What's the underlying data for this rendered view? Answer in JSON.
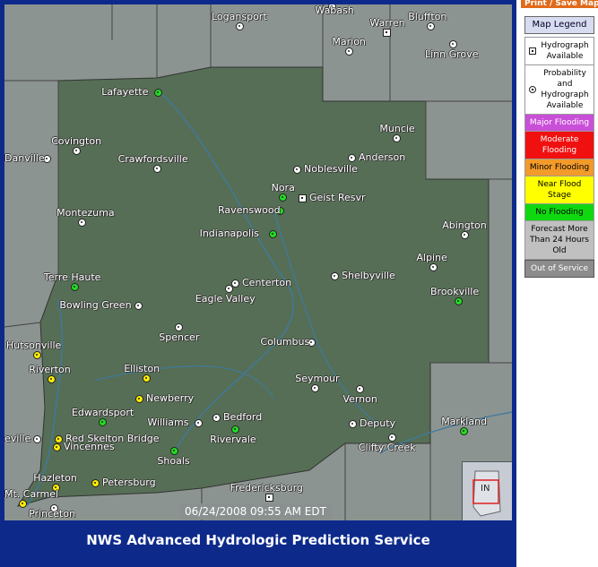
{
  "header": {
    "print_label": "Print / Save Map"
  },
  "legend": {
    "button_label": "Map Legend",
    "items": [
      {
        "label": "Hydrograph Available",
        "icon": "square-marker-icon"
      },
      {
        "label": "Probability and Hydrograph Available",
        "icon": "circle-marker-icon"
      },
      {
        "label": "Major Flooding",
        "color": "#c94fd8",
        "text_color": "#ffffff"
      },
      {
        "label": "Moderate Flooding",
        "color": "#f01010",
        "text_color": "#ffffff"
      },
      {
        "label": "Minor Flooding",
        "color": "#f29a2a",
        "text_color": "#000000"
      },
      {
        "label": "Near Flood Stage",
        "color": "#ffff00",
        "text_color": "#000000"
      },
      {
        "label": "No Flooding",
        "color": "#10d810",
        "text_color": "#000000"
      },
      {
        "label": "Forecast More Than 24 Hours Old",
        "color": "#c0c0c0",
        "text_color": "#000000"
      }
    ],
    "out_of_service_label": "Out of Service"
  },
  "map": {
    "timestamp": "06/24/2008 09:55 AM EDT",
    "inset_label": "IN",
    "stations": [
      {
        "name": "Logansport",
        "status": "white",
        "shape": "circle"
      },
      {
        "name": "Wabash",
        "status": "white",
        "shape": "circle"
      },
      {
        "name": "Warren",
        "status": "white",
        "shape": "square"
      },
      {
        "name": "Bluffton",
        "status": "white",
        "shape": "circle"
      },
      {
        "name": "Marion",
        "status": "white",
        "shape": "circle"
      },
      {
        "name": "Linn Grove",
        "status": "white",
        "shape": "circle"
      },
      {
        "name": "Lafayette",
        "status": "green",
        "shape": "circle"
      },
      {
        "name": "Danville",
        "status": "white",
        "shape": "circle"
      },
      {
        "name": "Covington",
        "status": "white",
        "shape": "circle"
      },
      {
        "name": "Crawfordsville",
        "status": "white",
        "shape": "circle"
      },
      {
        "name": "Muncie",
        "status": "white",
        "shape": "circle"
      },
      {
        "name": "Anderson",
        "status": "white",
        "shape": "circle"
      },
      {
        "name": "Noblesville",
        "status": "white",
        "shape": "circle"
      },
      {
        "name": "Nora",
        "status": "green",
        "shape": "circle"
      },
      {
        "name": "Ravenswood",
        "status": "green",
        "shape": "circle"
      },
      {
        "name": "Geist Resvr",
        "status": "white",
        "shape": "square"
      },
      {
        "name": "Montezuma",
        "status": "white",
        "shape": "circle"
      },
      {
        "name": "Indianapolis",
        "status": "green",
        "shape": "circle"
      },
      {
        "name": "Abington",
        "status": "white",
        "shape": "circle"
      },
      {
        "name": "Alpine",
        "status": "white",
        "shape": "circle"
      },
      {
        "name": "Terre Haute",
        "status": "green",
        "shape": "circle"
      },
      {
        "name": "Centerton",
        "status": "white",
        "shape": "circle"
      },
      {
        "name": "Shelbyville",
        "status": "white",
        "shape": "circle"
      },
      {
        "name": "Brookville",
        "status": "green",
        "shape": "circle"
      },
      {
        "name": "Eagle Valley",
        "status": "white",
        "shape": "circle"
      },
      {
        "name": "Bowling Green",
        "status": "white",
        "shape": "circle"
      },
      {
        "name": "Spencer",
        "status": "white",
        "shape": "circle"
      },
      {
        "name": "Hutsonville",
        "status": "yellow",
        "shape": "circle"
      },
      {
        "name": "Columbus",
        "status": "white",
        "shape": "circle"
      },
      {
        "name": "Riverton",
        "status": "yellow",
        "shape": "circle"
      },
      {
        "name": "Elliston",
        "status": "yellow",
        "shape": "circle"
      },
      {
        "name": "Seymour",
        "status": "white",
        "shape": "circle"
      },
      {
        "name": "Newberry",
        "status": "yellow",
        "shape": "circle"
      },
      {
        "name": "Vernon",
        "status": "white",
        "shape": "circle"
      },
      {
        "name": "Edwardsport",
        "status": "green",
        "shape": "circle"
      },
      {
        "name": "Williams",
        "status": "white",
        "shape": "circle"
      },
      {
        "name": "Bedford",
        "status": "white",
        "shape": "circle"
      },
      {
        "name": "Deputy",
        "status": "white",
        "shape": "circle"
      },
      {
        "name": "Markland",
        "status": "green",
        "shape": "circle"
      },
      {
        "name": "Rivervale",
        "status": "green",
        "shape": "circle"
      },
      {
        "name": "Red Skelton Bridge",
        "status": "yellow",
        "shape": "circle"
      },
      {
        "name": "Vincennes",
        "status": "yellow",
        "shape": "circle"
      },
      {
        "name": "Clifty Creek",
        "status": "white",
        "shape": "circle"
      },
      {
        "name": "Shoals",
        "status": "green",
        "shape": "circle"
      },
      {
        "name": "Hazleton",
        "status": "yellow",
        "shape": "circle"
      },
      {
        "name": "Petersburg",
        "status": "yellow",
        "shape": "circle"
      },
      {
        "name": "Fredericksburg",
        "status": "white",
        "shape": "square"
      },
      {
        "name": "Mt. Carmel",
        "status": "yellow",
        "shape": "circle"
      },
      {
        "name": "Princeton",
        "status": "white",
        "shape": "circle"
      },
      {
        "name": "eville",
        "status": "white",
        "shape": "circle"
      }
    ]
  },
  "footer": {
    "title": "NWS Advanced Hydrologic Prediction Service"
  },
  "colors": {
    "white": "#ffffff",
    "green": "#22dd22",
    "yellow": "#ffee00",
    "frame": "#0d2a8a"
  }
}
